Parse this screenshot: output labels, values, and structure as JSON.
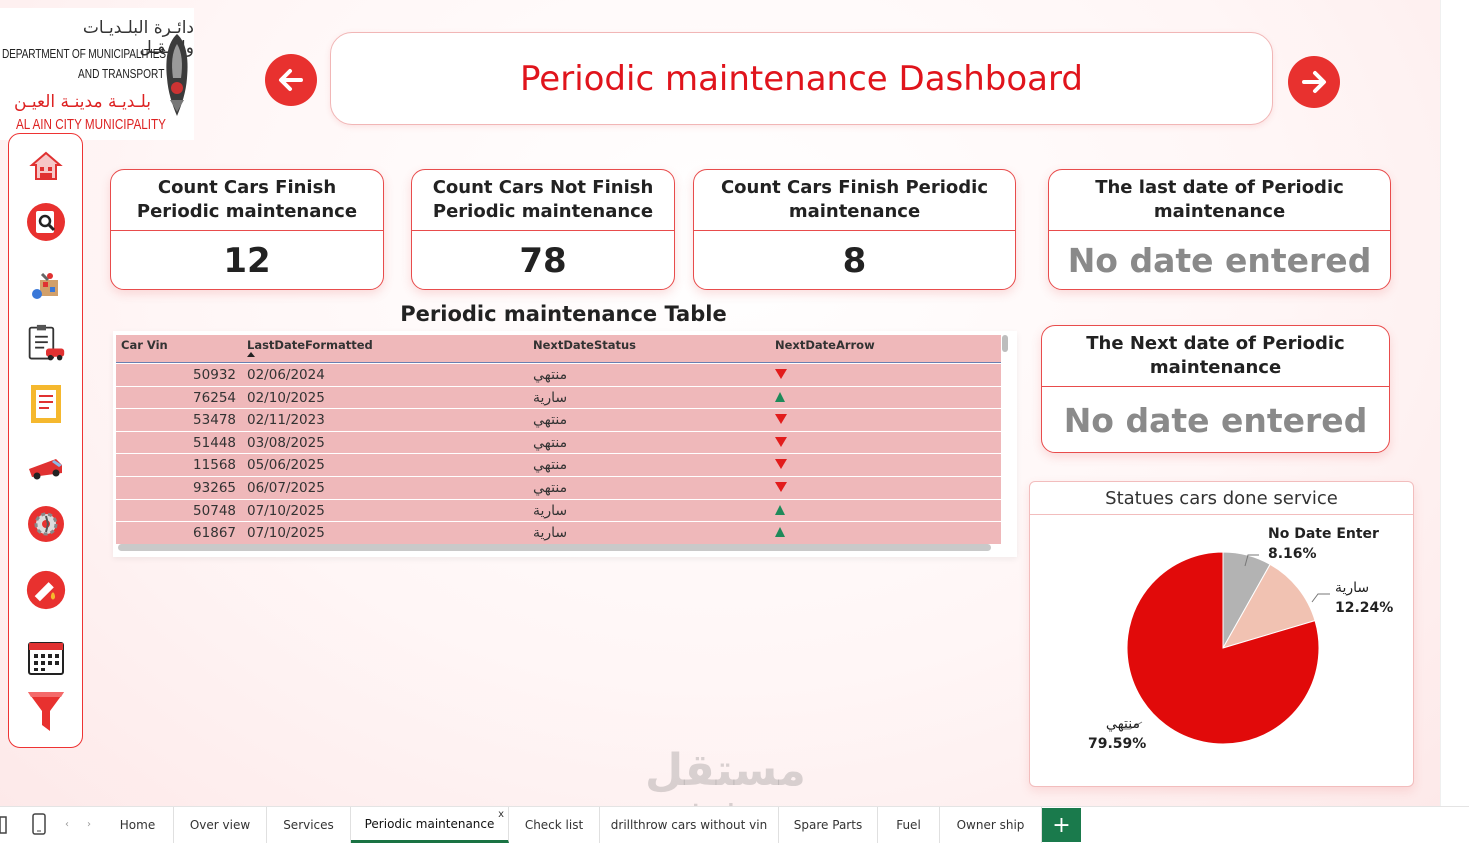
{
  "logo": {
    "arabic_top": "دائـرة البلـديـات والنـقـل",
    "english_line1": "DEPARTMENT OF MUNICIPALITIES",
    "english_line2": "AND TRANSPORT",
    "arabic_bottom": "بلـديـة مدينـة العيـن",
    "english_line3": "AL AIN CITY MUNICIPALITY"
  },
  "header": {
    "title": "Periodic maintenance Dashboard"
  },
  "sidebar": {
    "items": [
      {
        "icon": "home-icon"
      },
      {
        "icon": "search-icon"
      },
      {
        "icon": "services-icon"
      },
      {
        "icon": "checklist-car-icon"
      },
      {
        "icon": "document-icon"
      },
      {
        "icon": "truck-icon"
      },
      {
        "icon": "gear-icon"
      },
      {
        "icon": "fuel-icon"
      },
      {
        "icon": "calendar-icon"
      },
      {
        "icon": "filter-icon"
      }
    ]
  },
  "kpis": {
    "finish": {
      "label": "Count Cars Finish Periodic maintenance",
      "value": "12"
    },
    "not_finish": {
      "label": "Count Cars Not Finish Periodic maintenance",
      "value": "78"
    },
    "finish2": {
      "label": "Count Cars Finish Periodic maintenance",
      "value": "8"
    },
    "last_date": {
      "label": "The last date of Periodic maintenance",
      "value": "No date entered"
    },
    "next_date": {
      "label": "The Next date of Periodic maintenance",
      "value": "No date entered"
    }
  },
  "table": {
    "title": "Periodic maintenance Table",
    "columns": [
      "Car Vin",
      "LastDateFormatted",
      "NextDateStatus",
      "NextDateArrow"
    ],
    "rows": [
      {
        "vin": "50932",
        "date": "02/06/2024",
        "status": "منتهي",
        "arrow": "down"
      },
      {
        "vin": "76254",
        "date": "02/10/2025",
        "status": "سارية",
        "arrow": "up"
      },
      {
        "vin": "53478",
        "date": "02/11/2023",
        "status": "منتهي",
        "arrow": "down"
      },
      {
        "vin": "51448",
        "date": "03/08/2025",
        "status": "منتهي",
        "arrow": "down"
      },
      {
        "vin": "11568",
        "date": "05/06/2025",
        "status": "منتهي",
        "arrow": "down"
      },
      {
        "vin": "93265",
        "date": "06/07/2025",
        "status": "منتهي",
        "arrow": "down"
      },
      {
        "vin": "50748",
        "date": "07/10/2025",
        "status": "سارية",
        "arrow": "up"
      },
      {
        "vin": "61867",
        "date": "07/10/2025",
        "status": "سارية",
        "arrow": "up"
      }
    ]
  },
  "chart_data": {
    "type": "pie",
    "title": "Statues cars done service",
    "slices": [
      {
        "label": "No Date Enter",
        "value": 8.16,
        "display": "8.16%",
        "color": "#b3b3b3"
      },
      {
        "label": "سارية",
        "value": 12.24,
        "display": "12.24%",
        "color": "#f1c2b2"
      },
      {
        "label": "منتهي",
        "value": 79.59,
        "display": "79.59%",
        "color": "#e10a0a"
      }
    ]
  },
  "tabs": {
    "items": [
      "Home",
      "Over view",
      "Services",
      "Periodic maintenance",
      "Check list",
      "drillthrow cars without vin",
      "Spare Parts",
      "Fuel",
      "Owner ship"
    ],
    "active": "Periodic maintenance",
    "add_label": "+",
    "close_label": "x"
  },
  "watermark": {
    "arabic": "مستقل",
    "latin": "mostaql.com"
  },
  "colors": {
    "accent": "#e0141c",
    "table_row": "#efb8ba",
    "active_tab": "#1a7343"
  }
}
